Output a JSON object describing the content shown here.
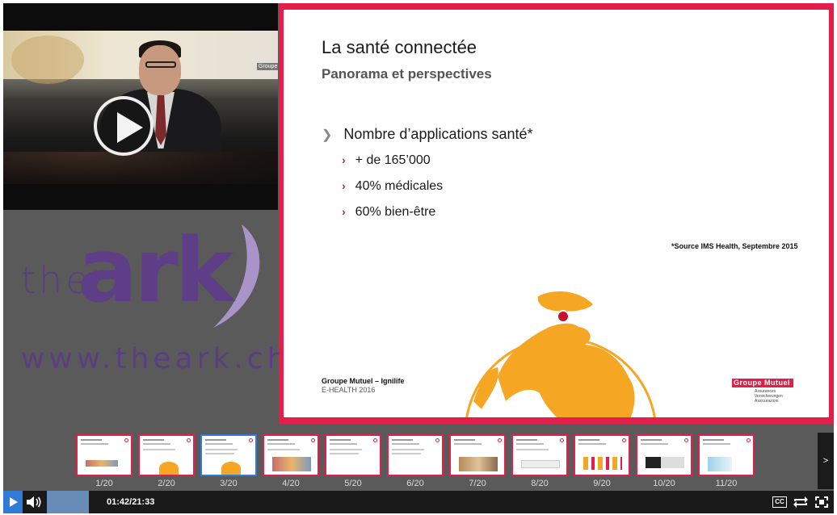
{
  "slide": {
    "title": "La santé connectée",
    "subtitle": "Panorama et perspectives",
    "main_bullet": "Nombre d’applications santé*",
    "sub_bullets": [
      "+ de 165’000",
      "40% médicales",
      "60% bien-être"
    ],
    "source": "*Source IMS Health, Septembre 2015",
    "footer_title": "Groupe Mutuel – Ignilife",
    "footer_subtitle": "E-HEALTH 2016",
    "logo_text": "Groupe Mutuel",
    "logo_sub": "Assurances Versicherungen Assicurazioni",
    "accent_color": "#e31e4a",
    "globe_color": "#f5a623"
  },
  "video": {
    "corner_logo": "Groupe",
    "play_icon": "play-circle-icon"
  },
  "branding": {
    "the": "the",
    "ark": "ark",
    "url": "www.theark.ch",
    "brand_color": "#5b3e82"
  },
  "thumbnails": {
    "items": [
      {
        "label": "1/20"
      },
      {
        "label": "2/20"
      },
      {
        "label": "3/20"
      },
      {
        "label": "4/20"
      },
      {
        "label": "5/20"
      },
      {
        "label": "6/20"
      },
      {
        "label": "7/20"
      },
      {
        "label": "8/20"
      },
      {
        "label": "9/20"
      },
      {
        "label": "10/20"
      },
      {
        "label": "11/20"
      }
    ],
    "active_index": 2,
    "next_label": ">"
  },
  "controls": {
    "time": "01:42/21:33",
    "cc_label": "CC",
    "progress_fraction": 0.079,
    "icons": [
      "play-icon",
      "volume-icon",
      "loop-icon",
      "fullscreen-icon"
    ]
  }
}
